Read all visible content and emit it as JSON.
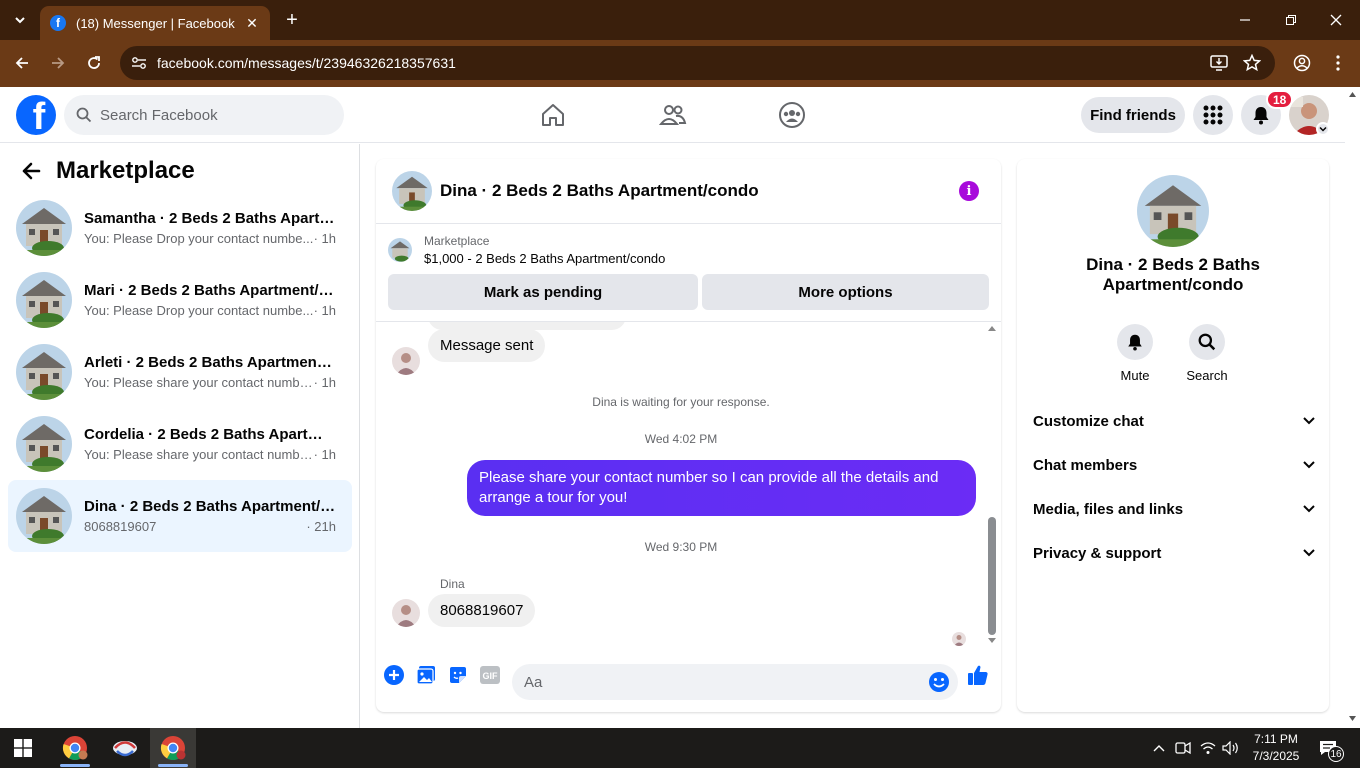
{
  "browser": {
    "tab_title": "(18) Messenger | Facebook",
    "url": "facebook.com/messages/t/23946326218357631"
  },
  "header": {
    "search_placeholder": "Search Facebook",
    "find_friends_label": "Find friends",
    "notification_count": "18"
  },
  "sidebar": {
    "title": "Marketplace",
    "conversations": [
      {
        "name": "Samantha · 2 Beds 2 Baths Apartm...",
        "preview": "You: Please Drop your contact numbe...",
        "time": " · 1h",
        "active": false
      },
      {
        "name": "Mari · 2 Beds 2 Baths Apartment/c...",
        "preview": "You: Please Drop your contact numbe...",
        "time": " · 1h",
        "active": false
      },
      {
        "name": "Arleti · 2 Beds 2 Baths Apartment/...",
        "preview": "You: Please share your contact numbe...",
        "time": " · 1h",
        "active": false
      },
      {
        "name": "Cordelia · 2 Beds 2 Baths Apartme...",
        "preview": "You: Please share your contact numbe...",
        "time": " · 1h",
        "active": false
      },
      {
        "name": "Dina · 2 Beds 2 Baths Apartment/c...",
        "preview": "8068819607",
        "time": " · 21h",
        "active": true
      }
    ]
  },
  "chat": {
    "title": "Dina · 2 Beds 2 Baths Apartment/condo",
    "banner_label": "Marketplace",
    "banner_listing": "$1,000 - 2 Beds 2 Baths Apartment/condo",
    "mark_pending_label": "Mark as pending",
    "more_options_label": "More options",
    "messages": {
      "msg_sent": "Message sent",
      "waiting": "Dina is waiting for your response.",
      "time1": "Wed 4:02 PM",
      "outgoing": "Please share your contact number so I can provide all the details and arrange a tour for you!",
      "time2": "Wed 9:30 PM",
      "sender": "Dina",
      "incoming": "8068819607"
    },
    "composer_placeholder": "Aa"
  },
  "info_panel": {
    "name": "Dina · 2 Beds 2 Baths Apartment/condo",
    "mute_label": "Mute",
    "search_label": "Search",
    "sections": [
      "Customize chat",
      "Chat members",
      "Media, files and links",
      "Privacy & support"
    ]
  },
  "taskbar": {
    "time": "7:11 PM",
    "date": "7/3/2025",
    "notification_count": "16"
  },
  "colors": {
    "fb_blue": "#0866ff",
    "outgoing_bubble": "#5a2ff2",
    "info_button": "#a80adb",
    "browser_tab_bg": "#6b3a16",
    "browser_strip_bg": "#3a1f0c"
  }
}
